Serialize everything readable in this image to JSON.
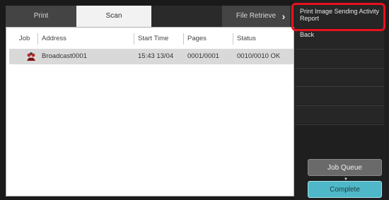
{
  "tabs": [
    {
      "label": "Print"
    },
    {
      "label": "Scan"
    },
    {
      "label": ""
    },
    {
      "label": "File Retrieve"
    }
  ],
  "tab_more_glyph": "›",
  "table": {
    "headers": [
      "Job",
      "Address",
      "Start Time",
      "Pages",
      "Status"
    ],
    "rows": [
      {
        "address": "Broadcast0001",
        "start_time": "15:43 13/04",
        "pages": "0001/0001",
        "status": "0010/0010 OK"
      }
    ]
  },
  "menu": {
    "print_report": "Print Image Sending Activity Report",
    "back": "Back"
  },
  "buttons": {
    "job_queue": "Job Queue",
    "complete": "Complete"
  },
  "colors": {
    "highlight": "#e8101e",
    "complete_button": "#4fb8c8",
    "selected_tab": "#f2f2f2"
  },
  "icons": [
    "broadcast-icon",
    "chevron-right-icon",
    "dropdown-arrow-icon"
  ]
}
